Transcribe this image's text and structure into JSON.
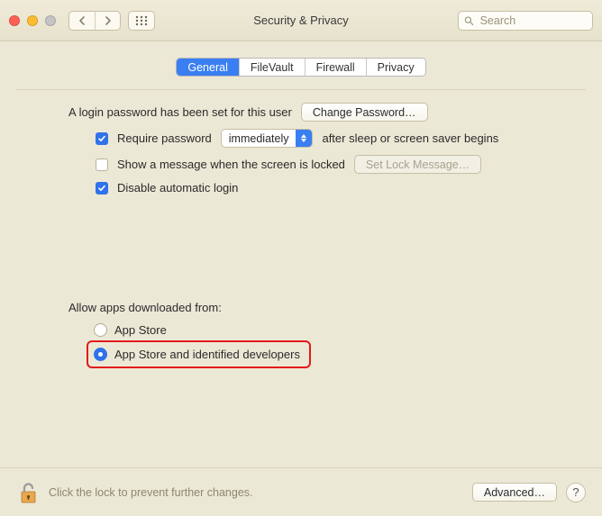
{
  "window": {
    "title": "Security & Privacy"
  },
  "search": {
    "placeholder": "Search",
    "value": ""
  },
  "tabs": {
    "items": [
      "General",
      "FileVault",
      "Firewall",
      "Privacy"
    ],
    "selected": 0
  },
  "general": {
    "login_password_text": "A login password has been set for this user",
    "change_password_label": "Change Password…",
    "require_password": {
      "checked": true,
      "pre_label": "Require password",
      "select_value": "immediately",
      "post_label": "after sleep or screen saver begins"
    },
    "show_message": {
      "checked": false,
      "label": "Show a message when the screen is locked",
      "button_label": "Set Lock Message…",
      "button_enabled": false
    },
    "disable_auto_login": {
      "checked": true,
      "label": "Disable automatic login"
    },
    "allow_apps": {
      "title": "Allow apps downloaded from:",
      "options": [
        {
          "label": "App Store",
          "selected": false
        },
        {
          "label": "App Store and identified developers",
          "selected": true
        }
      ]
    }
  },
  "footer": {
    "lock_text": "Click the lock to prevent further changes.",
    "advanced_label": "Advanced…",
    "help_label": "?"
  }
}
